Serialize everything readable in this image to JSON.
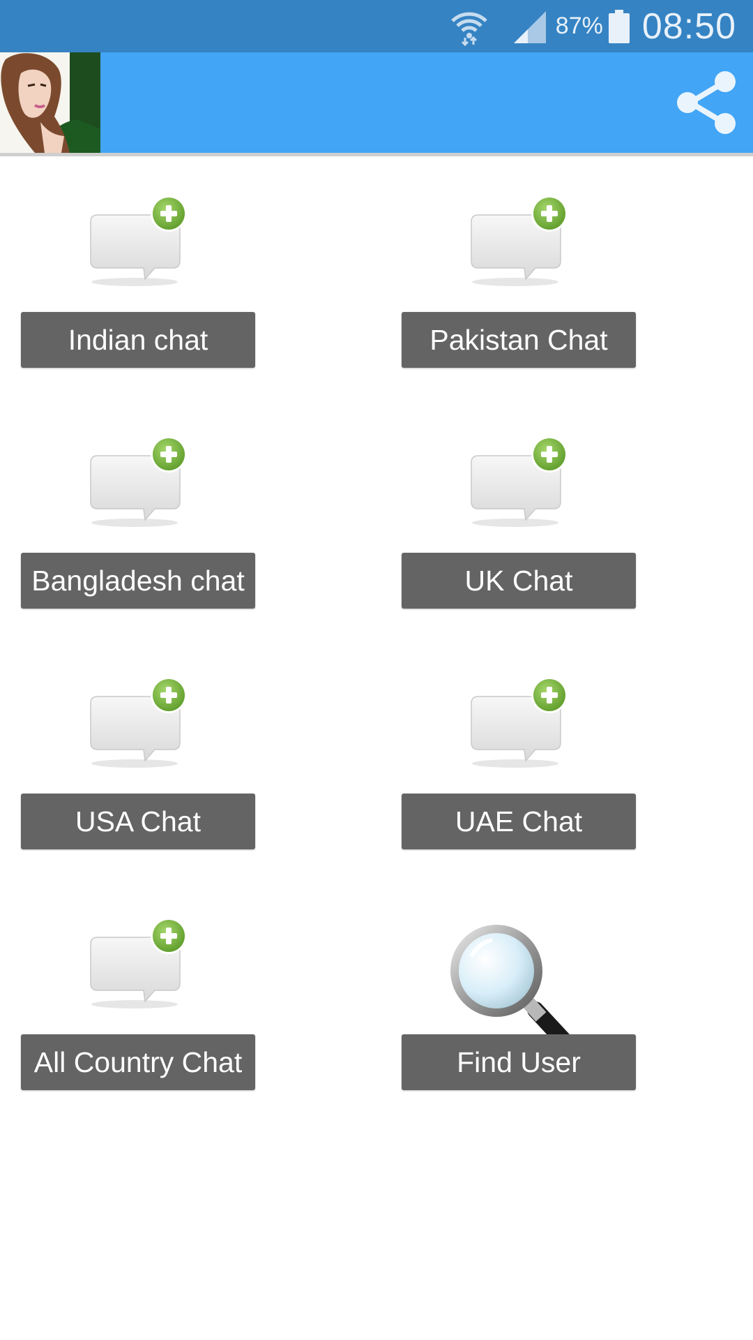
{
  "status_bar": {
    "battery_percent": "87%",
    "time": "08:50",
    "icons": [
      "wifi-icon",
      "signal-icon",
      "battery-icon"
    ]
  },
  "app_bar": {
    "avatar_icon": "user-avatar",
    "share_icon": "share-icon",
    "color": "#42a5f5"
  },
  "tiles": [
    {
      "label": "Indian chat",
      "icon": "chat-add-icon"
    },
    {
      "label": "Pakistan Chat",
      "icon": "chat-add-icon"
    },
    {
      "label": "Bangladesh chat",
      "icon": "chat-add-icon"
    },
    {
      "label": "UK Chat",
      "icon": "chat-add-icon"
    },
    {
      "label": "USA Chat",
      "icon": "chat-add-icon"
    },
    {
      "label": "UAE Chat",
      "icon": "chat-add-icon"
    },
    {
      "label": "All Country Chat",
      "icon": "chat-add-icon"
    },
    {
      "label": "Find User",
      "icon": "magnifier-icon"
    }
  ],
  "colors": {
    "status_bar": "#3583c3",
    "button": "#646464",
    "plus_badge": "#7cb342"
  }
}
